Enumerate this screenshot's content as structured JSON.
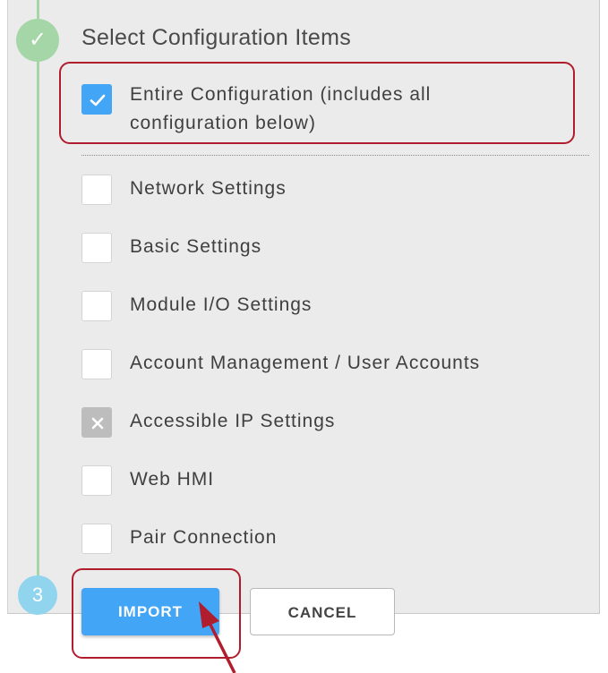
{
  "section": {
    "title": "Select Configuration Items",
    "step_done_icon": "✓",
    "step_number": "3"
  },
  "items": [
    {
      "label": "Entire Configuration (includes all configuration below)",
      "state": "checked"
    },
    {
      "label": "Network Settings",
      "state": "unchecked"
    },
    {
      "label": "Basic Settings",
      "state": "unchecked"
    },
    {
      "label": "Module I/O Settings",
      "state": "unchecked"
    },
    {
      "label": "Account Management / User Accounts",
      "state": "unchecked"
    },
    {
      "label": "Accessible IP Settings",
      "state": "excluded"
    },
    {
      "label": "Web HMI",
      "state": "unchecked"
    },
    {
      "label": "Pair Connection",
      "state": "unchecked"
    }
  ],
  "buttons": {
    "import": "IMPORT",
    "cancel": "CANCEL"
  },
  "colors": {
    "accent_blue": "#42a5f5",
    "step_done_green": "#a5d6a7",
    "step_pending_blue": "#90d4ee",
    "callout_red": "#b01e2d",
    "panel_bg": "#ebebeb"
  }
}
